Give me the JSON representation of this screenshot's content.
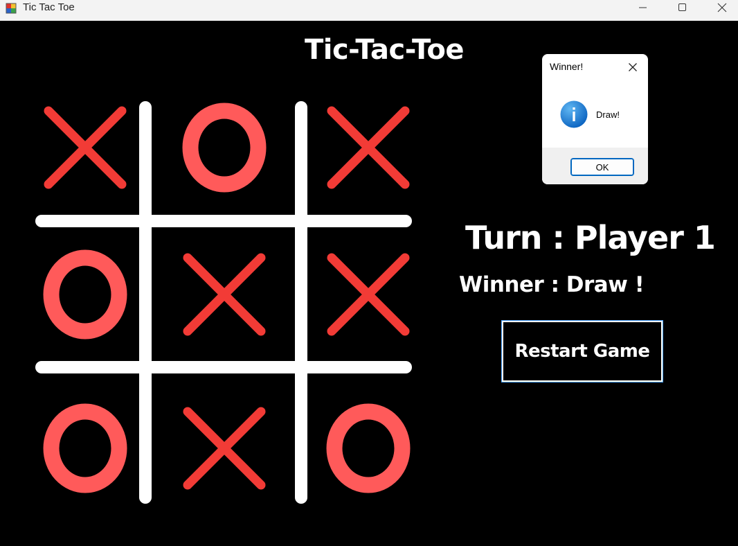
{
  "window": {
    "title": "Tic Tac Toe"
  },
  "game": {
    "title": "Tic-Tac-Toe",
    "board": [
      [
        "X",
        "O",
        "X"
      ],
      [
        "O",
        "X",
        "X"
      ],
      [
        "O",
        "X",
        "O"
      ]
    ],
    "turn_label": "Turn : Player 1",
    "winner_label": "Winner :  Draw !",
    "restart_label": "Restart Game"
  },
  "dialog": {
    "title": "Winner!",
    "message": "Draw!",
    "ok_label": "OK",
    "icon": "info-icon"
  },
  "colors": {
    "background": "#000000",
    "x_mark": "#f23b36",
    "o_mark": "#ff5a5a",
    "grid": "#ffffff",
    "info_blue": "#1a7fd6"
  }
}
